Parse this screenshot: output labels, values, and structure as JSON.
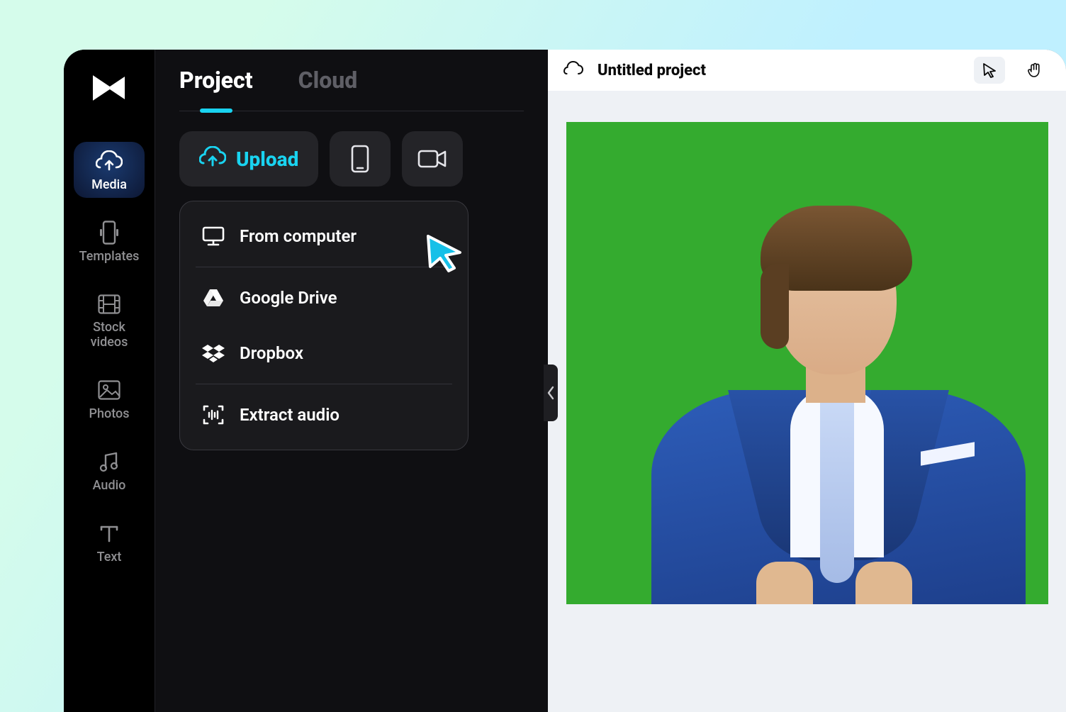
{
  "header": {
    "project_title": "Untitled project",
    "tools": {
      "select": "select",
      "hand": "hand"
    }
  },
  "rail": {
    "items": [
      {
        "key": "media",
        "label": "Media",
        "icon": "cloud-upload-icon",
        "active": true
      },
      {
        "key": "templates",
        "label": "Templates",
        "icon": "phone-icon",
        "active": false
      },
      {
        "key": "stock",
        "label": "Stock videos",
        "icon": "film-icon",
        "active": false
      },
      {
        "key": "photos",
        "label": "Photos",
        "icon": "image-icon",
        "active": false
      },
      {
        "key": "audio",
        "label": "Audio",
        "icon": "music-note-icon",
        "active": false
      },
      {
        "key": "text",
        "label": "Text",
        "icon": "text-icon",
        "active": false
      }
    ]
  },
  "panel": {
    "tabs": [
      {
        "key": "project",
        "label": "Project",
        "active": true
      },
      {
        "key": "cloud",
        "label": "Cloud",
        "active": false
      }
    ],
    "upload_button": {
      "label": "Upload"
    },
    "device_button": {
      "name": "upload-from-phone-button"
    },
    "camera_button": {
      "name": "record-from-camera-button"
    },
    "dropdown": [
      {
        "key": "computer",
        "label": "From computer",
        "icon": "monitor-icon"
      },
      {
        "sep": true
      },
      {
        "key": "gdrive",
        "label": "Google Drive",
        "icon": "google-drive-icon"
      },
      {
        "key": "dropbox",
        "label": "Dropbox",
        "icon": "dropbox-icon"
      },
      {
        "sep": true
      },
      {
        "key": "extract",
        "label": "Extract audio",
        "icon": "extract-audio-icon"
      }
    ]
  },
  "colors": {
    "accent": "#19d3f0",
    "greenscreen": "#34ab2f",
    "suit": "#2d5db9"
  },
  "canvas": {
    "content": "person-on-greenscreen"
  }
}
